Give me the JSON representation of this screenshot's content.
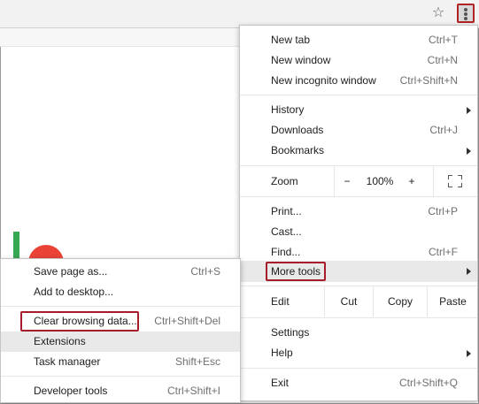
{
  "toolbar": {
    "star_icon": "star-icon",
    "menu_icon": "three-dot-menu-icon"
  },
  "main_menu": {
    "new_tab": {
      "label": "New tab",
      "shortcut": "Ctrl+T"
    },
    "new_window": {
      "label": "New window",
      "shortcut": "Ctrl+N"
    },
    "new_incognito": {
      "label": "New incognito window",
      "shortcut": "Ctrl+Shift+N"
    },
    "history": {
      "label": "History"
    },
    "downloads": {
      "label": "Downloads",
      "shortcut": "Ctrl+J"
    },
    "bookmarks": {
      "label": "Bookmarks"
    },
    "zoom": {
      "label": "Zoom",
      "minus": "−",
      "value": "100%",
      "plus": "+"
    },
    "print": {
      "label": "Print...",
      "shortcut": "Ctrl+P"
    },
    "cast": {
      "label": "Cast..."
    },
    "find": {
      "label": "Find...",
      "shortcut": "Ctrl+F"
    },
    "more_tools": {
      "label": "More tools"
    },
    "edit": {
      "label": "Edit",
      "cut": "Cut",
      "copy": "Copy",
      "paste": "Paste"
    },
    "settings": {
      "label": "Settings"
    },
    "help": {
      "label": "Help"
    },
    "exit": {
      "label": "Exit",
      "shortcut": "Ctrl+Shift+Q"
    }
  },
  "sub_menu": {
    "save_page": {
      "label": "Save page as...",
      "shortcut": "Ctrl+S"
    },
    "add_desktop": {
      "label": "Add to desktop..."
    },
    "clear_data": {
      "label": "Clear browsing data...",
      "shortcut": "Ctrl+Shift+Del"
    },
    "extensions": {
      "label": "Extensions"
    },
    "task_manager": {
      "label": "Task manager",
      "shortcut": "Shift+Esc"
    },
    "dev_tools": {
      "label": "Developer tools",
      "shortcut": "Ctrl+Shift+I"
    }
  },
  "colors": {
    "highlight": "#e9e9e9",
    "outline": "#a61c2a"
  }
}
